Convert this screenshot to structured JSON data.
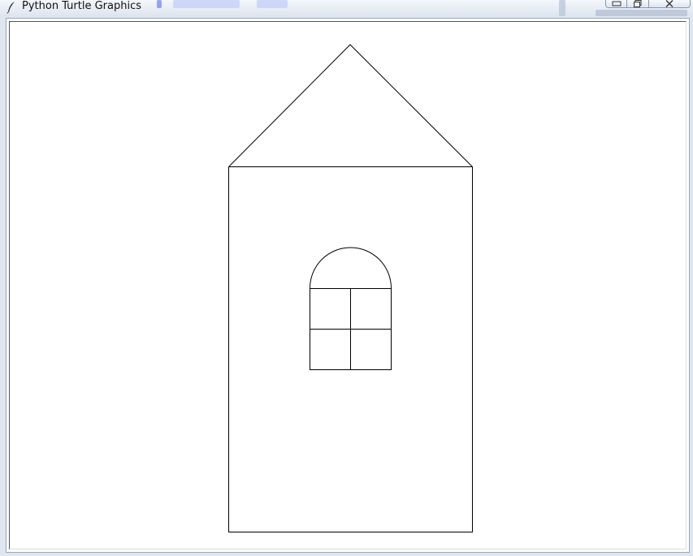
{
  "window": {
    "title": "Python Turtle Graphics"
  },
  "icons": {
    "app": "feather-icon",
    "minimize": "minimize-icon",
    "maximize": "maximize-icon",
    "close": "close-icon"
  },
  "canvas": {
    "background": "#ffffff",
    "stroke_color": "#000000"
  }
}
